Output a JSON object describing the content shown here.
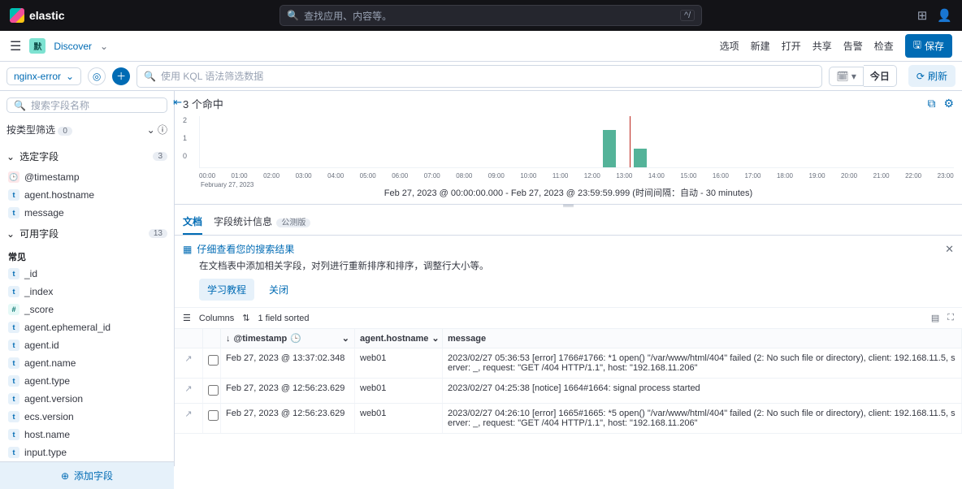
{
  "brand": "elastic",
  "top_search_placeholder": "查找应用、内容等。",
  "top_search_kbd": "^/",
  "env_badge": "默",
  "app_name": "Discover",
  "subnav": {
    "options": "选项",
    "new": "新建",
    "open": "打开",
    "share": "共享",
    "alerts": "告警",
    "inspect": "检查",
    "save": "保存"
  },
  "dataview": "nginx-error",
  "kql_placeholder": "使用 KQL 语法筛选数据",
  "date_label": "今日",
  "refresh_label": "刷新",
  "hits_text": "3 个命中",
  "time_caption": "Feb 27, 2023 @ 00:00:00.000 - Feb 27, 2023 @ 23:59:59.999   (时间间隔：自动 - 30 minutes)",
  "field_search_placeholder": "搜索字段名称",
  "type_filter": {
    "label": "按类型筛选",
    "count": "0"
  },
  "selected_section": {
    "label": "选定字段",
    "count": "3"
  },
  "available_section": {
    "label": "可用字段",
    "count": "13"
  },
  "selected_fields": [
    {
      "tok": "date",
      "icon": "🕒",
      "name": "@timestamp"
    },
    {
      "tok": "t",
      "icon": "t",
      "name": "agent.hostname"
    },
    {
      "tok": "t",
      "icon": "t",
      "name": "message"
    }
  ],
  "common_label": "常见",
  "available_fields": [
    {
      "tok": "t",
      "icon": "t",
      "name": "_id"
    },
    {
      "tok": "t",
      "icon": "t",
      "name": "_index"
    },
    {
      "tok": "n",
      "icon": "#",
      "name": "_score"
    },
    {
      "tok": "t",
      "icon": "t",
      "name": "agent.ephemeral_id"
    },
    {
      "tok": "t",
      "icon": "t",
      "name": "agent.id"
    },
    {
      "tok": "t",
      "icon": "t",
      "name": "agent.name"
    },
    {
      "tok": "t",
      "icon": "t",
      "name": "agent.type"
    },
    {
      "tok": "t",
      "icon": "t",
      "name": "agent.version"
    },
    {
      "tok": "t",
      "icon": "t",
      "name": "ecs.version"
    },
    {
      "tok": "t",
      "icon": "t",
      "name": "host.name"
    },
    {
      "tok": "t",
      "icon": "t",
      "name": "input.type"
    }
  ],
  "add_field": "添加字段",
  "tabs": {
    "docs": "文档",
    "stats": "字段统计信息",
    "beta": "公测版"
  },
  "tip_title": "仔细查看您的搜索结果",
  "tip_body": "在文档表中添加相关字段，对列进行重新排序和排序，调整行大小等。",
  "tip_learn": "学习教程",
  "tip_close": "关闭",
  "grid": {
    "columns": "Columns",
    "sorted": "1 field sorted"
  },
  "cols": {
    "ts": "@timestamp",
    "host": "agent.hostname",
    "msg": "message"
  },
  "chart_data": {
    "type": "bar",
    "categories": [
      "00:00",
      "01:00",
      "02:00",
      "03:00",
      "04:00",
      "05:00",
      "06:00",
      "07:00",
      "08:00",
      "09:00",
      "10:00",
      "11:00",
      "12:00",
      "13:00",
      "14:00",
      "15:00",
      "16:00",
      "17:00",
      "18:00",
      "19:00",
      "20:00",
      "21:00",
      "22:00",
      "23:00"
    ],
    "values": [
      0,
      0,
      0,
      0,
      0,
      0,
      0,
      0,
      0,
      0,
      0,
      0,
      2,
      1,
      0,
      0,
      0,
      0,
      0,
      0,
      0,
      0,
      0,
      0
    ],
    "x_date": "February 27, 2023",
    "y_ticks": [
      "2",
      "1",
      "0"
    ],
    "ylim": [
      0,
      2
    ]
  },
  "rows": [
    {
      "ts": "Feb 27, 2023 @ 13:37:02.348",
      "host": "web01",
      "msg": "2023/02/27 05:36:53 [error] 1766#1766: *1 open() \"/var/www/html/404\" failed (2: No such file or directory), client: 192.168.11.5, server: _, request: \"GET /404 HTTP/1.1\", host: \"192.168.11.206\""
    },
    {
      "ts": "Feb 27, 2023 @ 12:56:23.629",
      "host": "web01",
      "msg": "2023/02/27 04:25:38 [notice] 1664#1664: signal process started"
    },
    {
      "ts": "Feb 27, 2023 @ 12:56:23.629",
      "host": "web01",
      "msg": "2023/02/27 04:26:10 [error] 1665#1665: *5 open() \"/var/www/html/404\" failed (2: No such file or directory), client: 192.168.11.5, server: _, request: \"GET /404 HTTP/1.1\", host: \"192.168.11.206\""
    }
  ]
}
